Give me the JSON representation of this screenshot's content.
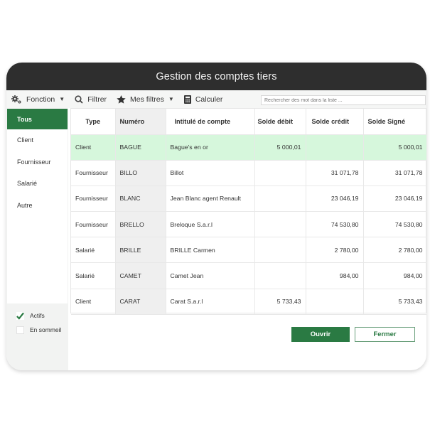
{
  "window": {
    "title": "Gestion des comptes tiers"
  },
  "toolbar": {
    "fonction_label": "Fonction",
    "filtrer_label": "Filtrer",
    "mes_filtres_label": "Mes filtres",
    "calculer_label": "Calculer",
    "search_placeholder": "Rechercher des mot dans la liste ...",
    "icons": [
      "gears-icon",
      "search-icon",
      "star-icon",
      "calculator-icon"
    ]
  },
  "sidebar": {
    "items": [
      {
        "label": "Tous",
        "active": true
      },
      {
        "label": "Client"
      },
      {
        "label": "Fournisseur"
      },
      {
        "label": "Salarié"
      },
      {
        "label": "Autre"
      }
    ],
    "filters": [
      {
        "label": "Actifs",
        "checked": true
      },
      {
        "label": "En sommeil",
        "checked": false
      }
    ]
  },
  "table": {
    "columns": [
      "Type",
      "Numéro",
      "Intitulé de compte",
      "Solde débit",
      "Solde crédit",
      "Solde Signé"
    ],
    "rows": [
      {
        "type": "Client",
        "numero": "BAGUE",
        "intitule": "Bague's en or",
        "debit": "5 000,01",
        "credit": "",
        "signe": "5 000,01",
        "selected": true
      },
      {
        "type": "Fournisseur",
        "numero": "BILLO",
        "intitule": "Billot",
        "debit": "",
        "credit": "31 071,78",
        "signe": "31 071,78"
      },
      {
        "type": "Fournisseur",
        "numero": "BLANC",
        "intitule": "Jean Blanc agent Renault",
        "debit": "",
        "credit": "23 046,19",
        "signe": "23 046,19"
      },
      {
        "type": "Fournisseur",
        "numero": "BRELLO",
        "intitule": "Breloque S.a.r.l",
        "debit": "",
        "credit": "74 530,80",
        "signe": "74 530,80"
      },
      {
        "type": "Salarié",
        "numero": "BRILLE",
        "intitule": "BRILLE Carmen",
        "debit": "",
        "credit": "2 780,00",
        "signe": "2 780,00"
      },
      {
        "type": "Salarié",
        "numero": "CAMET",
        "intitule": "Camet Jean",
        "debit": "",
        "credit": "984,00",
        "signe": "984,00"
      },
      {
        "type": "Client",
        "numero": "CARAT",
        "intitule": "Carat S.a.r.l",
        "debit": "5 733,43",
        "credit": "",
        "signe": "5 733,43"
      }
    ]
  },
  "buttons": {
    "open_label": "Ouvrir",
    "close_label": "Fermer"
  },
  "colors": {
    "accent": "#2a7a43",
    "titlebar": "#2e2e2e",
    "selected_row": "#d6f7dc"
  }
}
